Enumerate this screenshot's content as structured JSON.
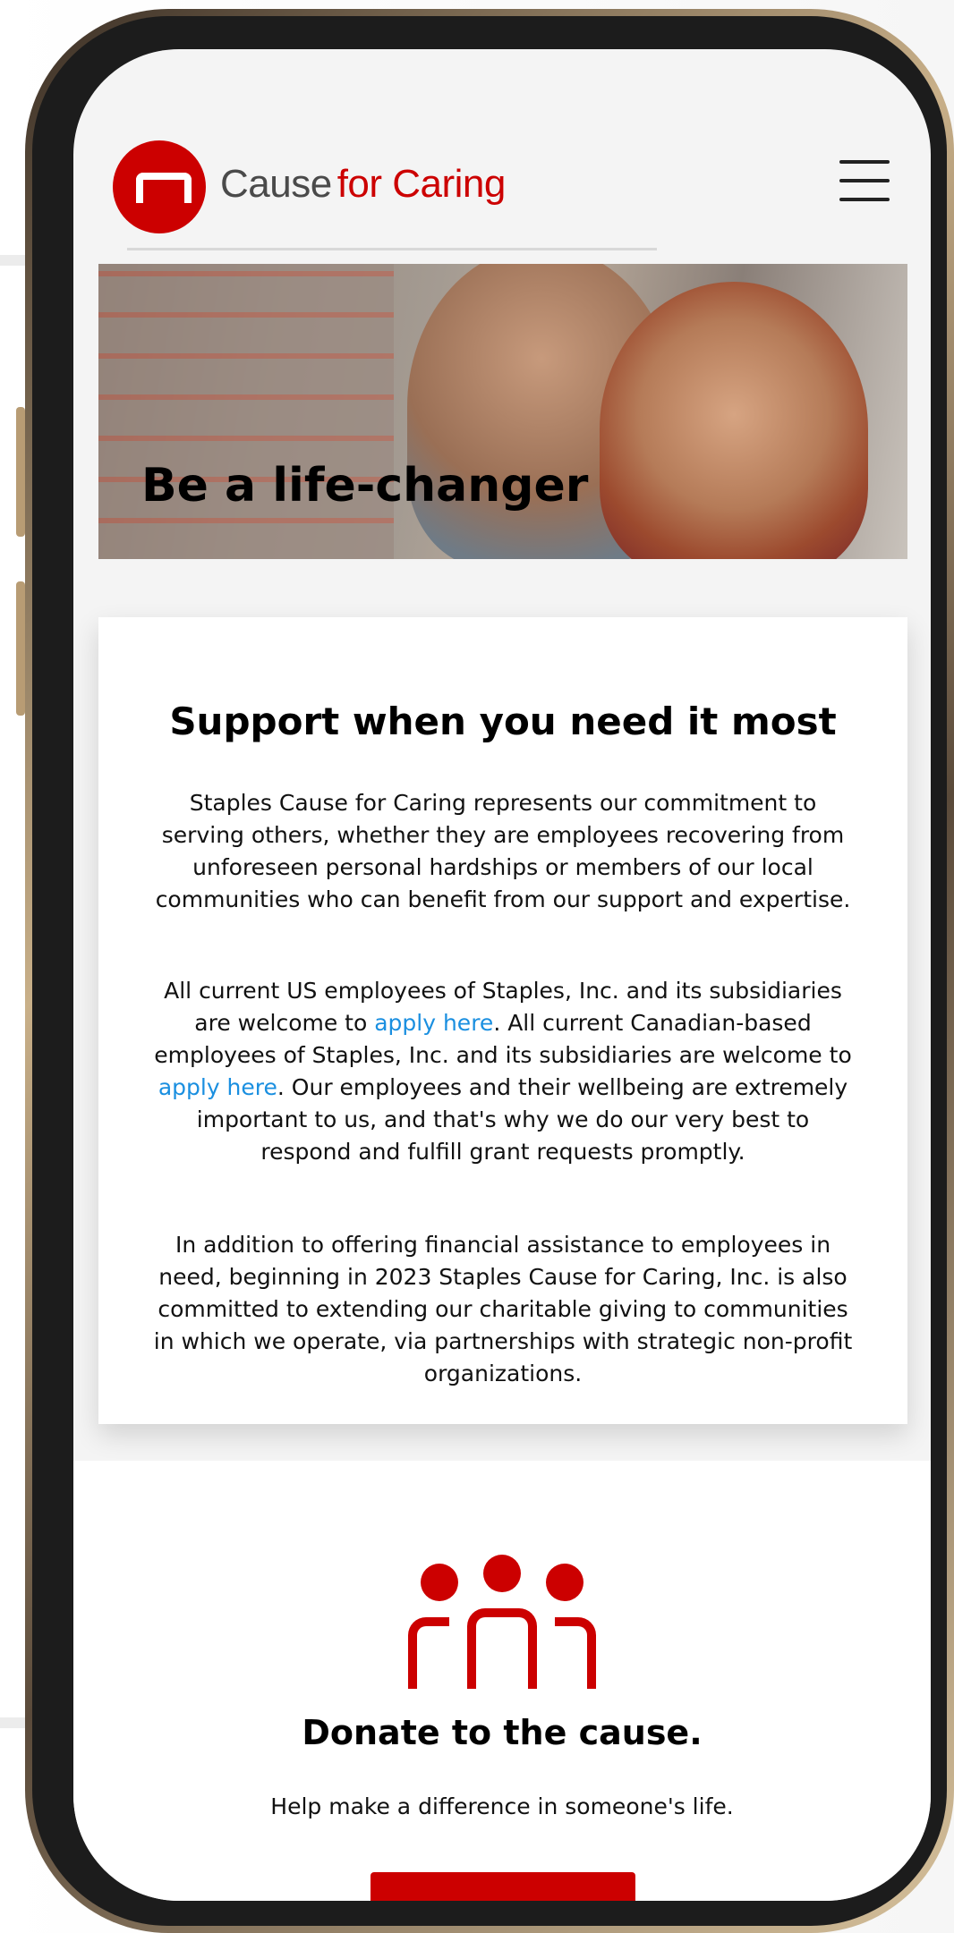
{
  "header": {
    "brand_part1": "Cause",
    "brand_part2": "for Caring"
  },
  "hero": {
    "title": "Be a life-changer"
  },
  "support": {
    "heading": "Support when you need it most",
    "paragraph1": "Staples Cause for Caring represents our commitment to serving others, whether they are employees recovering from unforeseen personal hardships or members of our local communities who can benefit from our support and expertise.",
    "paragraph2_part1": "All current US employees of Staples, Inc. and its subsidiaries are welcome to ",
    "apply_link_us": "apply here",
    "paragraph2_part2": ". All current Canadian-based employees of Staples, Inc. and its subsidiaries are welcome to ",
    "apply_link_ca": "apply here",
    "paragraph2_part3": ". Our employees and their wellbeing are extremely important to us, and that's why we do our very best to respond and fulfill grant requests promptly.",
    "paragraph3": "In addition to offering financial assistance to employees in need, beginning in 2023 Staples Cause for Caring, Inc. is also committed to extending our charitable giving to communities in which we operate, via partnerships with strategic non-profit organizations."
  },
  "donate": {
    "heading": "Donate to the cause.",
    "subtext": "Help make a difference in someone's life."
  },
  "colors": {
    "brand_red": "#cc0000",
    "link_blue": "#1a8fe0"
  }
}
